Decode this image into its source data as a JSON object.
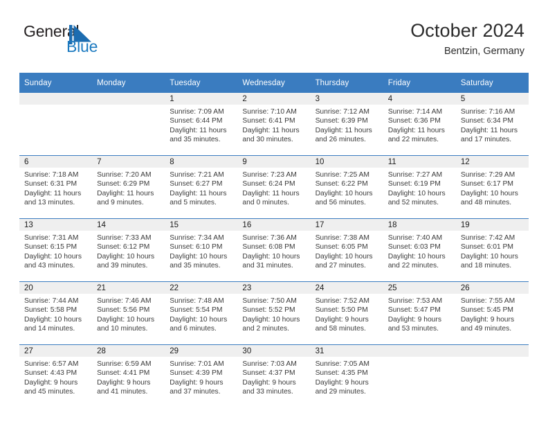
{
  "logo": {
    "word_one": "General",
    "word_two": "Blue",
    "mark": "triangle-flag-icon",
    "color_dark": "#231f20",
    "color_blue": "#1c7ac0"
  },
  "header": {
    "title": "October 2024",
    "location": "Bentzin, Germany"
  },
  "theme": {
    "header_blue": "#3a7cc0",
    "daynum_band": "#efefef",
    "text": "#3a3a3a"
  },
  "weekday_headers": [
    "Sunday",
    "Monday",
    "Tuesday",
    "Wednesday",
    "Thursday",
    "Friday",
    "Saturday"
  ],
  "weeks": [
    [
      {
        "day": "",
        "empty": true,
        "sunrise": "",
        "sunset": "",
        "daylight_line1": "",
        "daylight_line2": ""
      },
      {
        "day": "",
        "empty": true,
        "sunrise": "",
        "sunset": "",
        "daylight_line1": "",
        "daylight_line2": ""
      },
      {
        "day": "1",
        "sunrise": "Sunrise: 7:09 AM",
        "sunset": "Sunset: 6:44 PM",
        "daylight_line1": "Daylight: 11 hours",
        "daylight_line2": "and 35 minutes."
      },
      {
        "day": "2",
        "sunrise": "Sunrise: 7:10 AM",
        "sunset": "Sunset: 6:41 PM",
        "daylight_line1": "Daylight: 11 hours",
        "daylight_line2": "and 30 minutes."
      },
      {
        "day": "3",
        "sunrise": "Sunrise: 7:12 AM",
        "sunset": "Sunset: 6:39 PM",
        "daylight_line1": "Daylight: 11 hours",
        "daylight_line2": "and 26 minutes."
      },
      {
        "day": "4",
        "sunrise": "Sunrise: 7:14 AM",
        "sunset": "Sunset: 6:36 PM",
        "daylight_line1": "Daylight: 11 hours",
        "daylight_line2": "and 22 minutes."
      },
      {
        "day": "5",
        "sunrise": "Sunrise: 7:16 AM",
        "sunset": "Sunset: 6:34 PM",
        "daylight_line1": "Daylight: 11 hours",
        "daylight_line2": "and 17 minutes."
      }
    ],
    [
      {
        "day": "6",
        "sunrise": "Sunrise: 7:18 AM",
        "sunset": "Sunset: 6:31 PM",
        "daylight_line1": "Daylight: 11 hours",
        "daylight_line2": "and 13 minutes."
      },
      {
        "day": "7",
        "sunrise": "Sunrise: 7:20 AM",
        "sunset": "Sunset: 6:29 PM",
        "daylight_line1": "Daylight: 11 hours",
        "daylight_line2": "and 9 minutes."
      },
      {
        "day": "8",
        "sunrise": "Sunrise: 7:21 AM",
        "sunset": "Sunset: 6:27 PM",
        "daylight_line1": "Daylight: 11 hours",
        "daylight_line2": "and 5 minutes."
      },
      {
        "day": "9",
        "sunrise": "Sunrise: 7:23 AM",
        "sunset": "Sunset: 6:24 PM",
        "daylight_line1": "Daylight: 11 hours",
        "daylight_line2": "and 0 minutes."
      },
      {
        "day": "10",
        "sunrise": "Sunrise: 7:25 AM",
        "sunset": "Sunset: 6:22 PM",
        "daylight_line1": "Daylight: 10 hours",
        "daylight_line2": "and 56 minutes."
      },
      {
        "day": "11",
        "sunrise": "Sunrise: 7:27 AM",
        "sunset": "Sunset: 6:19 PM",
        "daylight_line1": "Daylight: 10 hours",
        "daylight_line2": "and 52 minutes."
      },
      {
        "day": "12",
        "sunrise": "Sunrise: 7:29 AM",
        "sunset": "Sunset: 6:17 PM",
        "daylight_line1": "Daylight: 10 hours",
        "daylight_line2": "and 48 minutes."
      }
    ],
    [
      {
        "day": "13",
        "sunrise": "Sunrise: 7:31 AM",
        "sunset": "Sunset: 6:15 PM",
        "daylight_line1": "Daylight: 10 hours",
        "daylight_line2": "and 43 minutes."
      },
      {
        "day": "14",
        "sunrise": "Sunrise: 7:33 AM",
        "sunset": "Sunset: 6:12 PM",
        "daylight_line1": "Daylight: 10 hours",
        "daylight_line2": "and 39 minutes."
      },
      {
        "day": "15",
        "sunrise": "Sunrise: 7:34 AM",
        "sunset": "Sunset: 6:10 PM",
        "daylight_line1": "Daylight: 10 hours",
        "daylight_line2": "and 35 minutes."
      },
      {
        "day": "16",
        "sunrise": "Sunrise: 7:36 AM",
        "sunset": "Sunset: 6:08 PM",
        "daylight_line1": "Daylight: 10 hours",
        "daylight_line2": "and 31 minutes."
      },
      {
        "day": "17",
        "sunrise": "Sunrise: 7:38 AM",
        "sunset": "Sunset: 6:05 PM",
        "daylight_line1": "Daylight: 10 hours",
        "daylight_line2": "and 27 minutes."
      },
      {
        "day": "18",
        "sunrise": "Sunrise: 7:40 AM",
        "sunset": "Sunset: 6:03 PM",
        "daylight_line1": "Daylight: 10 hours",
        "daylight_line2": "and 22 minutes."
      },
      {
        "day": "19",
        "sunrise": "Sunrise: 7:42 AM",
        "sunset": "Sunset: 6:01 PM",
        "daylight_line1": "Daylight: 10 hours",
        "daylight_line2": "and 18 minutes."
      }
    ],
    [
      {
        "day": "20",
        "sunrise": "Sunrise: 7:44 AM",
        "sunset": "Sunset: 5:58 PM",
        "daylight_line1": "Daylight: 10 hours",
        "daylight_line2": "and 14 minutes."
      },
      {
        "day": "21",
        "sunrise": "Sunrise: 7:46 AM",
        "sunset": "Sunset: 5:56 PM",
        "daylight_line1": "Daylight: 10 hours",
        "daylight_line2": "and 10 minutes."
      },
      {
        "day": "22",
        "sunrise": "Sunrise: 7:48 AM",
        "sunset": "Sunset: 5:54 PM",
        "daylight_line1": "Daylight: 10 hours",
        "daylight_line2": "and 6 minutes."
      },
      {
        "day": "23",
        "sunrise": "Sunrise: 7:50 AM",
        "sunset": "Sunset: 5:52 PM",
        "daylight_line1": "Daylight: 10 hours",
        "daylight_line2": "and 2 minutes."
      },
      {
        "day": "24",
        "sunrise": "Sunrise: 7:52 AM",
        "sunset": "Sunset: 5:50 PM",
        "daylight_line1": "Daylight: 9 hours",
        "daylight_line2": "and 58 minutes."
      },
      {
        "day": "25",
        "sunrise": "Sunrise: 7:53 AM",
        "sunset": "Sunset: 5:47 PM",
        "daylight_line1": "Daylight: 9 hours",
        "daylight_line2": "and 53 minutes."
      },
      {
        "day": "26",
        "sunrise": "Sunrise: 7:55 AM",
        "sunset": "Sunset: 5:45 PM",
        "daylight_line1": "Daylight: 9 hours",
        "daylight_line2": "and 49 minutes."
      }
    ],
    [
      {
        "day": "27",
        "sunrise": "Sunrise: 6:57 AM",
        "sunset": "Sunset: 4:43 PM",
        "daylight_line1": "Daylight: 9 hours",
        "daylight_line2": "and 45 minutes."
      },
      {
        "day": "28",
        "sunrise": "Sunrise: 6:59 AM",
        "sunset": "Sunset: 4:41 PM",
        "daylight_line1": "Daylight: 9 hours",
        "daylight_line2": "and 41 minutes."
      },
      {
        "day": "29",
        "sunrise": "Sunrise: 7:01 AM",
        "sunset": "Sunset: 4:39 PM",
        "daylight_line1": "Daylight: 9 hours",
        "daylight_line2": "and 37 minutes."
      },
      {
        "day": "30",
        "sunrise": "Sunrise: 7:03 AM",
        "sunset": "Sunset: 4:37 PM",
        "daylight_line1": "Daylight: 9 hours",
        "daylight_line2": "and 33 minutes."
      },
      {
        "day": "31",
        "sunrise": "Sunrise: 7:05 AM",
        "sunset": "Sunset: 4:35 PM",
        "daylight_line1": "Daylight: 9 hours",
        "daylight_line2": "and 29 minutes."
      },
      {
        "day": "",
        "empty": true,
        "sunrise": "",
        "sunset": "",
        "daylight_line1": "",
        "daylight_line2": ""
      },
      {
        "day": "",
        "empty": true,
        "sunrise": "",
        "sunset": "",
        "daylight_line1": "",
        "daylight_line2": ""
      }
    ]
  ]
}
